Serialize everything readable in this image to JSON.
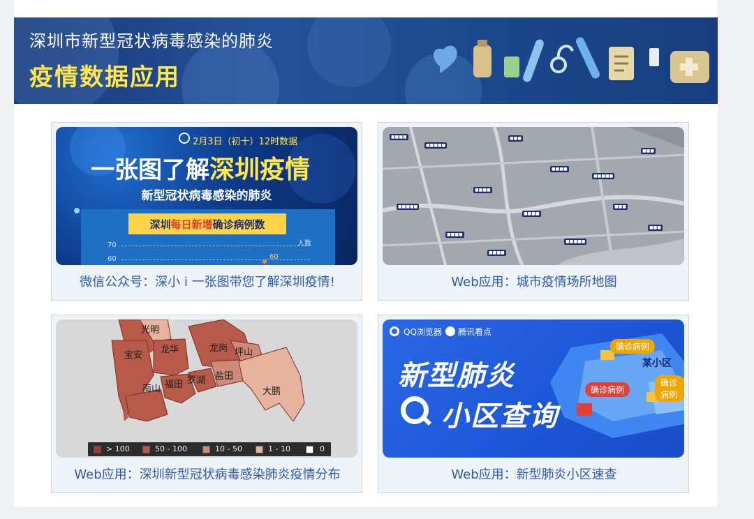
{
  "banner": {
    "title": "深圳市新型冠状病毒感染的肺炎",
    "subtitle": "疫情数据应用"
  },
  "cards": [
    {
      "caption": "微信公众号：深小 i 一张图带您了解深圳疫情!",
      "thumb": {
        "date": "2月3日（初十）12时数据",
        "headline_a": "一张图了解",
        "headline_b": "深圳疫情",
        "subhead": "新型冠状病毒感染的肺炎",
        "bar_a": "深圳",
        "bar_b": "每日新增",
        "bar_c": "确诊病例数",
        "axis_70": "70",
        "axis_60": "60",
        "unit": "人数",
        "point_label": "60"
      }
    },
    {
      "caption": "Web应用：城市疫情场所地图"
    },
    {
      "caption": "Web应用：深圳新型冠状病毒感染肺炎疫情分布",
      "thumb": {
        "districts": [
          "光明",
          "宝安",
          "龙华",
          "龙岗",
          "坪山",
          "南山",
          "福田",
          "罗湖",
          "盐田",
          "大鹏"
        ],
        "legend": [
          "> 100",
          "50 - 100",
          "10 - 50",
          "1 - 10",
          "0"
        ],
        "legend_colors": [
          "#9e3a2f",
          "#b85a4a",
          "#cf8a78",
          "#e6b49e",
          "#ffffff"
        ]
      }
    },
    {
      "caption": "Web应用：新型肺炎小区速查",
      "thumb": {
        "brand_a": "QQ浏览器",
        "brand_b": "腾讯看点",
        "line1": "新型肺炎",
        "line2": "小区查询",
        "tag_confirmed": "确诊病例",
        "area_label": "某小区"
      }
    }
  ],
  "colors": {
    "caption": "#2d5aa6",
    "banner_subtitle": "#ffe84a"
  }
}
